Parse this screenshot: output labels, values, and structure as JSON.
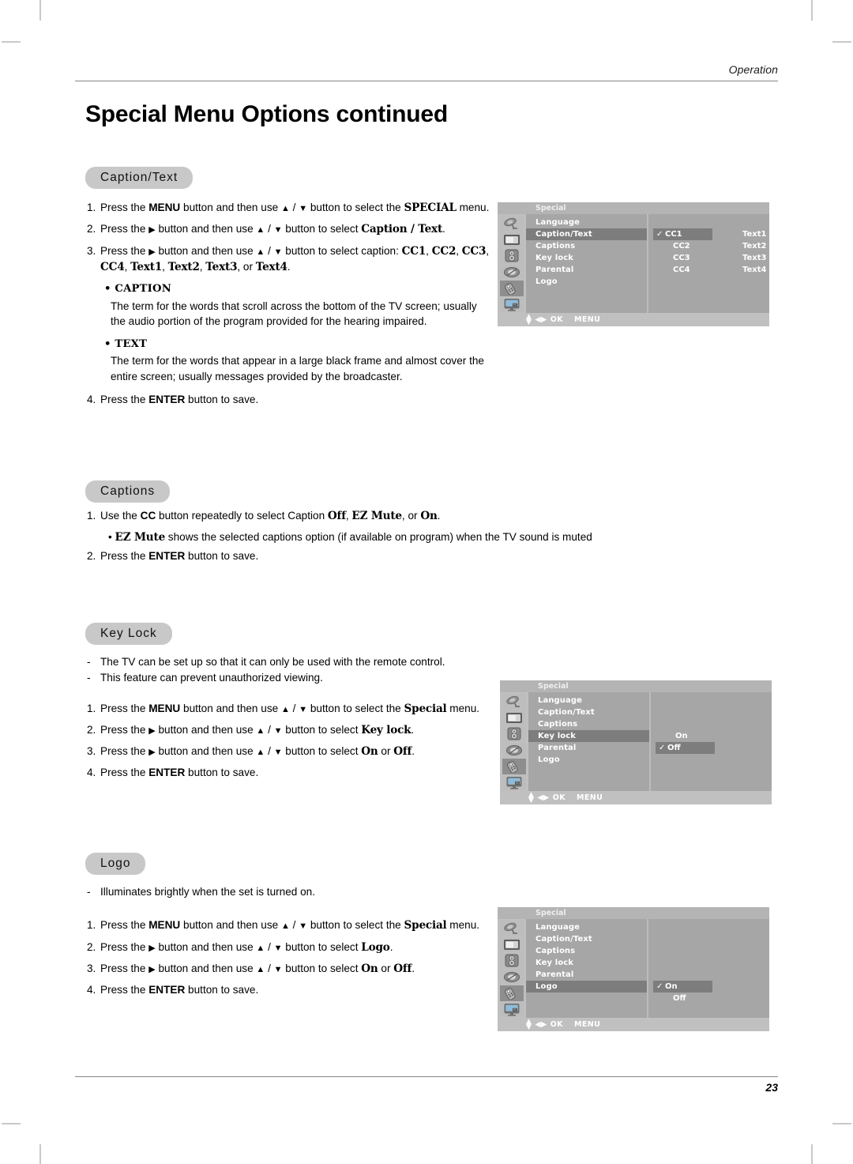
{
  "page": {
    "running_head": "Operation",
    "title": "Special Menu Options continued",
    "number": "23"
  },
  "sections": {
    "caption_text": {
      "pill_label": "Caption/Text",
      "steps": [
        {
          "num": "1.",
          "parts": [
            {
              "t": "Press the ",
              "s": "n"
            },
            {
              "t": "MENU",
              "s": "b"
            },
            {
              "t": " button and then use ",
              "s": "n"
            },
            {
              "t": "▲",
              "s": "tri"
            },
            {
              "t": " / ",
              "s": "n"
            },
            {
              "t": "▼",
              "s": "tri"
            },
            {
              "t": " button to select the ",
              "s": "n"
            },
            {
              "t": "SPECIAL",
              "s": "bser"
            },
            {
              "t": " menu.",
              "s": "n"
            }
          ]
        },
        {
          "num": "2.",
          "parts": [
            {
              "t": "Press the ",
              "s": "n"
            },
            {
              "t": "▶",
              "s": "tri"
            },
            {
              "t": " button and then use ",
              "s": "n"
            },
            {
              "t": "▲",
              "s": "tri"
            },
            {
              "t": " / ",
              "s": "n"
            },
            {
              "t": "▼",
              "s": "tri"
            },
            {
              "t": " button to select ",
              "s": "n"
            },
            {
              "t": "Caption / Text",
              "s": "bser"
            },
            {
              "t": ".",
              "s": "n"
            }
          ]
        },
        {
          "num": "3.",
          "parts": [
            {
              "t": "Press the ",
              "s": "n"
            },
            {
              "t": "▶",
              "s": "tri"
            },
            {
              "t": " button and then use ",
              "s": "n"
            },
            {
              "t": "▲",
              "s": "tri"
            },
            {
              "t": " / ",
              "s": "n"
            },
            {
              "t": "▼",
              "s": "tri"
            },
            {
              "t": " button to select caption: ",
              "s": "n"
            },
            {
              "t": "CC1",
              "s": "bser"
            },
            {
              "t": ", ",
              "s": "n"
            },
            {
              "t": "CC2",
              "s": "bser"
            },
            {
              "t": ", ",
              "s": "n"
            },
            {
              "t": "CC3",
              "s": "bser"
            },
            {
              "t": ", ",
              "s": "n"
            },
            {
              "t": "CC4",
              "s": "bser"
            },
            {
              "t": ", ",
              "s": "n"
            },
            {
              "t": "Text1",
              "s": "bser"
            },
            {
              "t": ", ",
              "s": "n"
            },
            {
              "t": "Text2",
              "s": "bser"
            },
            {
              "t": ", ",
              "s": "n"
            },
            {
              "t": "Text3",
              "s": "bser"
            },
            {
              "t": ", or ",
              "s": "n"
            },
            {
              "t": "Text4",
              "s": "bser"
            },
            {
              "t": ".",
              "s": "n"
            }
          ]
        }
      ],
      "definitions": [
        {
          "term": "• CAPTION",
          "body": "The term for the words that scroll across the bottom of the TV screen; usually the audio portion of the program provided for the hearing impaired."
        },
        {
          "term": "• TEXT",
          "body": "The term for the words that appear in a large black frame and almost cover the entire screen; usually messages provided by the broadcaster."
        }
      ],
      "final_step": {
        "num": "4.",
        "parts": [
          {
            "t": "Press the ",
            "s": "n"
          },
          {
            "t": "ENTER",
            "s": "b"
          },
          {
            "t": " button to save.",
            "s": "n"
          }
        ]
      }
    },
    "captions": {
      "pill_label": "Captions",
      "steps": [
        {
          "num": "1.",
          "parts": [
            {
              "t": "Use the ",
              "s": "n"
            },
            {
              "t": "CC",
              "s": "b"
            },
            {
              "t": " button repeatedly to select Caption ",
              "s": "n"
            },
            {
              "t": "Off",
              "s": "bser"
            },
            {
              "t": ", ",
              "s": "n"
            },
            {
              "t": "EZ Mute",
              "s": "bser"
            },
            {
              "t": ", or ",
              "s": "n"
            },
            {
              "t": "On",
              "s": "bser"
            },
            {
              "t": ".",
              "s": "n"
            }
          ]
        },
        {
          "num": "",
          "indent": true,
          "parts": [
            {
              "t": "• ",
              "s": "n"
            },
            {
              "t": "EZ Mute",
              "s": "bser"
            },
            {
              "t": " shows the selected captions option (if available on program) when the TV sound is muted",
              "s": "n"
            }
          ]
        },
        {
          "num": "2.",
          "parts": [
            {
              "t": "Press the ",
              "s": "n"
            },
            {
              "t": "ENTER",
              "s": "b"
            },
            {
              "t": " button to save.",
              "s": "n"
            }
          ]
        }
      ]
    },
    "key_lock": {
      "pill_label": "Key Lock",
      "dashes": [
        "The TV can be set up so that it can only be used with the remote control.",
        "This feature can prevent unauthorized viewing."
      ],
      "steps": [
        {
          "num": "1.",
          "parts": [
            {
              "t": "Press the ",
              "s": "n"
            },
            {
              "t": "MENU",
              "s": "b"
            },
            {
              "t": " button and then use ",
              "s": "n"
            },
            {
              "t": "▲",
              "s": "tri"
            },
            {
              "t": " / ",
              "s": "n"
            },
            {
              "t": "▼",
              "s": "tri"
            },
            {
              "t": " button to select the ",
              "s": "n"
            },
            {
              "t": "Special",
              "s": "bser"
            },
            {
              "t": " menu.",
              "s": "n"
            }
          ]
        },
        {
          "num": "2.",
          "parts": [
            {
              "t": "Press the ",
              "s": "n"
            },
            {
              "t": "▶",
              "s": "tri"
            },
            {
              "t": " button and then use ",
              "s": "n"
            },
            {
              "t": "▲",
              "s": "tri"
            },
            {
              "t": " / ",
              "s": "n"
            },
            {
              "t": "▼",
              "s": "tri"
            },
            {
              "t": " button to select ",
              "s": "n"
            },
            {
              "t": "Key lock",
              "s": "bser"
            },
            {
              "t": ".",
              "s": "n"
            }
          ]
        },
        {
          "num": "3.",
          "parts": [
            {
              "t": "Press the ",
              "s": "n"
            },
            {
              "t": "▶",
              "s": "tri"
            },
            {
              "t": " button and then use ",
              "s": "n"
            },
            {
              "t": "▲",
              "s": "tri"
            },
            {
              "t": " / ",
              "s": "n"
            },
            {
              "t": "▼",
              "s": "tri"
            },
            {
              "t": " button to select ",
              "s": "n"
            },
            {
              "t": "On",
              "s": "bser"
            },
            {
              "t": " or ",
              "s": "n"
            },
            {
              "t": "Off",
              "s": "bser"
            },
            {
              "t": ".",
              "s": "n"
            }
          ]
        },
        {
          "num": "4.",
          "parts": [
            {
              "t": "Press the ",
              "s": "n"
            },
            {
              "t": "ENTER",
              "s": "b"
            },
            {
              "t": " button to save.",
              "s": "n"
            }
          ]
        }
      ]
    },
    "logo": {
      "pill_label": "Logo",
      "dashes": [
        "Illuminates brightly when the set is turned on."
      ],
      "steps": [
        {
          "num": "1.",
          "parts": [
            {
              "t": "Press the ",
              "s": "n"
            },
            {
              "t": "MENU",
              "s": "b"
            },
            {
              "t": " button and then use ",
              "s": "n"
            },
            {
              "t": "▲",
              "s": "tri"
            },
            {
              "t": " / ",
              "s": "n"
            },
            {
              "t": "▼",
              "s": "tri"
            },
            {
              "t": " button to select the ",
              "s": "n"
            },
            {
              "t": "Special",
              "s": "bser"
            },
            {
              "t": " menu.",
              "s": "n"
            }
          ]
        },
        {
          "num": "2.",
          "parts": [
            {
              "t": "Press the ",
              "s": "n"
            },
            {
              "t": "▶",
              "s": "tri"
            },
            {
              "t": " button and then use ",
              "s": "n"
            },
            {
              "t": "▲",
              "s": "tri"
            },
            {
              "t": " / ",
              "s": "n"
            },
            {
              "t": "▼",
              "s": "tri"
            },
            {
              "t": " button to select ",
              "s": "n"
            },
            {
              "t": "Logo",
              "s": "bser"
            },
            {
              "t": ".",
              "s": "n"
            }
          ]
        },
        {
          "num": "3.",
          "parts": [
            {
              "t": "Press the ",
              "s": "n"
            },
            {
              "t": "▶",
              "s": "tri"
            },
            {
              "t": " button and then use ",
              "s": "n"
            },
            {
              "t": "▲",
              "s": "tri"
            },
            {
              "t": " / ",
              "s": "n"
            },
            {
              "t": "▼",
              "s": "tri"
            },
            {
              "t": " button to select ",
              "s": "n"
            },
            {
              "t": "On",
              "s": "bser"
            },
            {
              "t": " or ",
              "s": "n"
            },
            {
              "t": "Off",
              "s": "bser"
            },
            {
              "t": ".",
              "s": "n"
            }
          ]
        },
        {
          "num": "4.",
          "parts": [
            {
              "t": "Press the ",
              "s": "n"
            },
            {
              "t": "ENTER",
              "s": "b"
            },
            {
              "t": " button to save.",
              "s": "n"
            }
          ]
        }
      ]
    }
  },
  "osd_common": {
    "title": "Special",
    "menu_items": [
      "Language",
      "Caption/Text",
      "Captions",
      "Key lock",
      "Parental",
      "Logo"
    ],
    "icons": [
      "satellite-dish-icon",
      "picture-screen-icon",
      "audio-speaker-icon",
      "clock-timer-icon",
      "special-remote-icon",
      "pc-monitor-icon"
    ],
    "selected_icon_index": 4,
    "footer": {
      "updown": "▲▼",
      "leftright": "◀▶",
      "ok": "OK",
      "menu": "MENU"
    },
    "check_glyph": "✓"
  },
  "osd_screens": [
    {
      "name": "caption-text-osd",
      "selected_menu_index": 1,
      "columns": [
        {
          "values": [
            "CC1",
            "CC2",
            "CC3",
            "CC4"
          ],
          "selected_index": 0
        },
        {
          "values": [
            "Text1",
            "Text2",
            "Text3",
            "Text4"
          ],
          "selected_index": -1
        }
      ]
    },
    {
      "name": "key-lock-osd",
      "selected_menu_index": 3,
      "columns": [
        {
          "values": [
            "On",
            "Off"
          ],
          "selected_index": 1
        }
      ]
    },
    {
      "name": "logo-osd",
      "selected_menu_index": 5,
      "columns": [
        {
          "values": [
            "On",
            "Off"
          ],
          "selected_index": 0
        }
      ]
    }
  ],
  "colors": {
    "osd_background": "#a6a6a6",
    "osd_highlight": "#7d7d7d",
    "osd_chrome": "#c0c0c0",
    "pill_grey": "#c8c8c8",
    "rule_grey": "#868686"
  }
}
